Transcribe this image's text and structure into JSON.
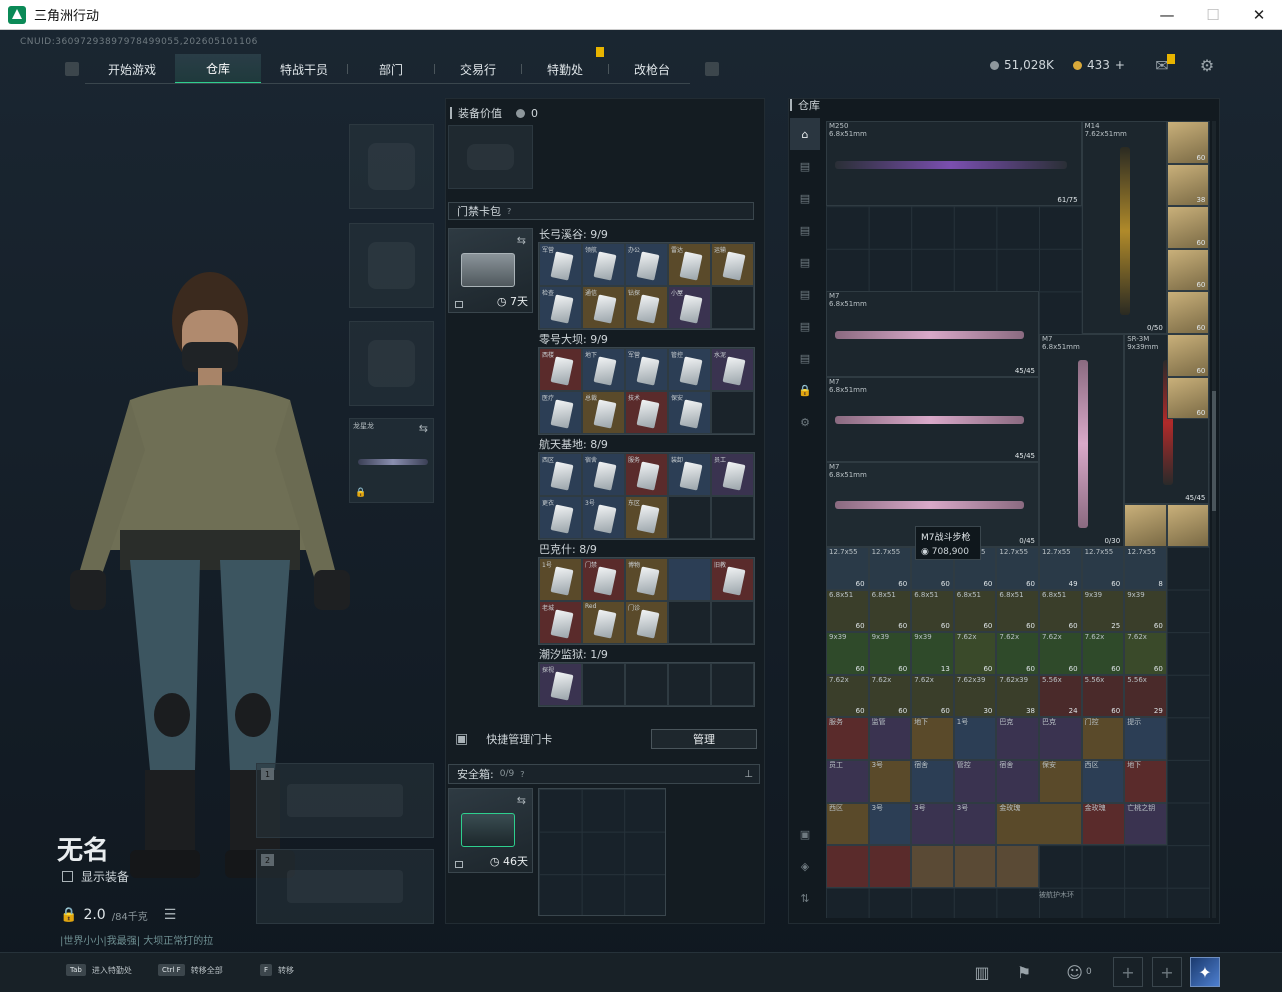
{
  "window": {
    "title": "三角洲行动",
    "min": "—",
    "max": "☐",
    "close": "✕"
  },
  "uid": "CNUID:36097293897978499055,202605101106",
  "nav": {
    "tabs": [
      "开始游戏",
      "仓库",
      "特战干员",
      "部门",
      "交易行",
      "特勤处",
      "改枪台"
    ],
    "active_index": 1
  },
  "currency": {
    "havoc": "51,028K",
    "coin": "433",
    "plus": "+"
  },
  "player": {
    "name": "无名",
    "show_equipment": "显示装备",
    "weight": "2.0",
    "weight_max": "/84千克",
    "motto": "|世界小小|我最强| 大坝正常打的拉"
  },
  "slots": {
    "secure_label": "安全箱",
    "weapon_slot_1": "1",
    "weapon_slot_2": "2",
    "knife_label": "龙星龙"
  },
  "mid": {
    "equip_value_label": "装备价值",
    "equip_value": "0",
    "keycard_pack": "门禁卡包",
    "keycard_help": "?",
    "keycard_time": "7天",
    "groups": [
      {
        "title": "长弓溪谷: 9/9",
        "cards": [
          {
            "t": "军营",
            "c": "c-blue"
          },
          {
            "t": "领航",
            "c": "c-blue"
          },
          {
            "t": "办公",
            "c": "c-blue"
          },
          {
            "t": "雷达",
            "c": "c-gold"
          },
          {
            "t": "运输",
            "c": "c-gold"
          },
          {
            "t": "检查",
            "c": "c-blue"
          },
          {
            "t": "通信",
            "c": "c-gold"
          },
          {
            "t": "钻探",
            "c": "c-gold"
          },
          {
            "t": "小屋",
            "c": "c-purple"
          },
          {
            "t": "",
            "c": "c-empty"
          }
        ]
      },
      {
        "title": "零号大坝: 9/9",
        "cards": [
          {
            "t": "西楼",
            "c": "c-red"
          },
          {
            "t": "地下",
            "c": "c-blue"
          },
          {
            "t": "军营",
            "c": "c-blue"
          },
          {
            "t": "管控",
            "c": "c-blue"
          },
          {
            "t": "水泥",
            "c": "c-purple"
          },
          {
            "t": "医疗",
            "c": "c-blue"
          },
          {
            "t": "总裁",
            "c": "c-gold"
          },
          {
            "t": "技术",
            "c": "c-red"
          },
          {
            "t": "保安",
            "c": "c-blue"
          },
          {
            "t": "",
            "c": "c-empty"
          }
        ]
      },
      {
        "title": "航天基地: 8/9",
        "cards": [
          {
            "t": "西区",
            "c": "c-blue"
          },
          {
            "t": "宿舍",
            "c": "c-blue"
          },
          {
            "t": "服务",
            "c": "c-red"
          },
          {
            "t": "装卸",
            "c": "c-blue"
          },
          {
            "t": "员工",
            "c": "c-purple"
          },
          {
            "t": "更衣",
            "c": "c-blue"
          },
          {
            "t": "3号",
            "c": "c-blue"
          },
          {
            "t": "东区",
            "c": "c-gold"
          },
          {
            "t": "",
            "c": "c-empty"
          },
          {
            "t": "",
            "c": "c-empty"
          }
        ]
      },
      {
        "title": "巴克什: 8/9",
        "cards": [
          {
            "t": "1号",
            "c": "c-gold"
          },
          {
            "t": "门禁",
            "c": "c-red"
          },
          {
            "t": "博物",
            "c": "c-gold"
          },
          {
            "t": "",
            "c": "c-blue"
          },
          {
            "t": "旧教",
            "c": "c-red"
          },
          {
            "t": "老城",
            "c": "c-red"
          },
          {
            "t": "Red",
            "c": "c-gold"
          },
          {
            "t": "门诊",
            "c": "c-gold"
          },
          {
            "t": "",
            "c": "c-empty"
          },
          {
            "t": "",
            "c": "c-empty"
          }
        ]
      },
      {
        "title": "潮汐监狱: 1/9",
        "cards": [
          {
            "t": "探视",
            "c": "c-purple"
          },
          {
            "t": "",
            "c": "c-empty"
          },
          {
            "t": "",
            "c": "c-empty"
          },
          {
            "t": "",
            "c": "c-empty"
          },
          {
            "t": "",
            "c": "c-empty"
          }
        ]
      }
    ],
    "quick_manage": "快捷管理门卡",
    "manage_btn": "管理",
    "safebox_label": "安全箱:",
    "safebox_count": "0/9",
    "safebox_help": "?",
    "safebox_time": "46天"
  },
  "right": {
    "title": "仓库",
    "weapons": [
      {
        "name": "M250",
        "cal": "6.8x51mm",
        "ammo": "61/75"
      },
      {
        "name": "M14",
        "cal": "7.62x51mm",
        "ammo": "0/50"
      },
      {
        "name": "M7",
        "cal": "6.8x51mm",
        "ammo": "45/45"
      },
      {
        "name": "M7",
        "cal": "6.8x51mm",
        "ammo": "45/45"
      },
      {
        "name": "M7",
        "cal": "6.8x51mm",
        "ammo": "0/45"
      },
      {
        "name": "M7",
        "cal": "6.8x51mm",
        "ammo": "0/30"
      },
      {
        "name": "SR-3M",
        "cal": "9x39mm",
        "ammo": "45/45"
      }
    ],
    "tooltip_name": "M7战斗步枪",
    "tooltip_price": "708,900",
    "ammo_row1": [
      [
        "12.7x55",
        "60"
      ],
      [
        "12.7x55",
        "60"
      ],
      [
        "12.7x55",
        "60"
      ],
      [
        "12.7x55",
        "60"
      ],
      [
        "12.7x55",
        "60"
      ],
      [
        "12.7x55",
        "49"
      ],
      [
        "12.7x55",
        "60"
      ],
      [
        "12.7x55",
        "8"
      ]
    ],
    "ammo_row2": [
      [
        "6.8x51",
        "60"
      ],
      [
        "6.8x51",
        "60"
      ],
      [
        "6.8x51",
        "60"
      ],
      [
        "6.8x51",
        "60"
      ],
      [
        "6.8x51",
        "60"
      ],
      [
        "6.8x51",
        "60"
      ],
      [
        "9x39",
        "25"
      ],
      [
        "9x39",
        "60"
      ]
    ],
    "ammo_row3": [
      [
        "9x39",
        "60"
      ],
      [
        "9x39",
        "60"
      ],
      [
        "9x39",
        "13"
      ],
      [
        "7.62x",
        "60"
      ],
      [
        "7.62x",
        "60"
      ],
      [
        "7.62x",
        "60"
      ],
      [
        "7.62x",
        "60"
      ],
      [
        "7.62x",
        "60"
      ]
    ],
    "ammo_row4": [
      [
        "7.62x",
        "60"
      ],
      [
        "7.62x",
        "60"
      ],
      [
        "7.62x",
        "60"
      ],
      [
        "7.62x39",
        "30"
      ],
      [
        "7.62x39",
        "38"
      ],
      [
        "5.56x",
        "24"
      ],
      [
        "5.56x",
        "60"
      ],
      [
        "5.56x",
        "29"
      ]
    ],
    "loot_row1": [
      "服务",
      "监管",
      "地下",
      "1号",
      "巴克",
      "巴克",
      "门控",
      "提示"
    ],
    "loot_row2": [
      "员工",
      "3号",
      "宿舍",
      "管控",
      "宿舍",
      "保安",
      "西区",
      "地下"
    ],
    "loot_row3": [
      "西区",
      "3号",
      "3号",
      "3号",
      "金玫瑰",
      "",
      "金玫瑰",
      "亡桃之钥"
    ],
    "bottom_label": "被航护木环",
    "ammo_side_counts": [
      "60",
      "38",
      "60",
      "60",
      "60",
      "60",
      "60"
    ]
  },
  "hints": [
    {
      "key": "Tab",
      "text": "进入特勤处"
    },
    {
      "key": "Ctrl F",
      "text": "转移全部"
    },
    {
      "key": "F",
      "text": "转移"
    }
  ],
  "bottom_right": {
    "friends": "0"
  }
}
